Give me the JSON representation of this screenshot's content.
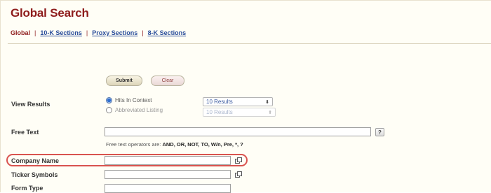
{
  "header": {
    "title": "Global Search"
  },
  "nav": {
    "current": "Global",
    "links": [
      "10-K Sections",
      "Proxy Sections",
      "8-K Sections"
    ]
  },
  "buttons": {
    "submit": "Submit",
    "clear": "Clear"
  },
  "view_results": {
    "label": "View Results",
    "options": [
      {
        "label": "Hits In Context",
        "selected": true,
        "dropdown": "10 Results"
      },
      {
        "label": "Abbreviated Listing",
        "selected": false,
        "dropdown": "10 Results"
      }
    ]
  },
  "free_text": {
    "label": "Free Text",
    "value": "",
    "help_label": "?",
    "operators_prefix": "Free text operators are:",
    "operators": "AND, OR, NOT, TO, W/n, Pre, *, ?"
  },
  "fields": [
    {
      "label": "Company Name",
      "value": "",
      "highlighted": true
    },
    {
      "label": "Ticker Symbols",
      "value": ""
    },
    {
      "label": "Form Type",
      "value": ""
    }
  ],
  "colors": {
    "title": "#8e1c1c",
    "link": "#2b4e9b",
    "highlight": "#d9534f",
    "background": "#fffef6"
  },
  "icons": {
    "lookup": "lookup-icon",
    "help": "help-icon",
    "select_arrow": "updown-arrow-icon"
  }
}
